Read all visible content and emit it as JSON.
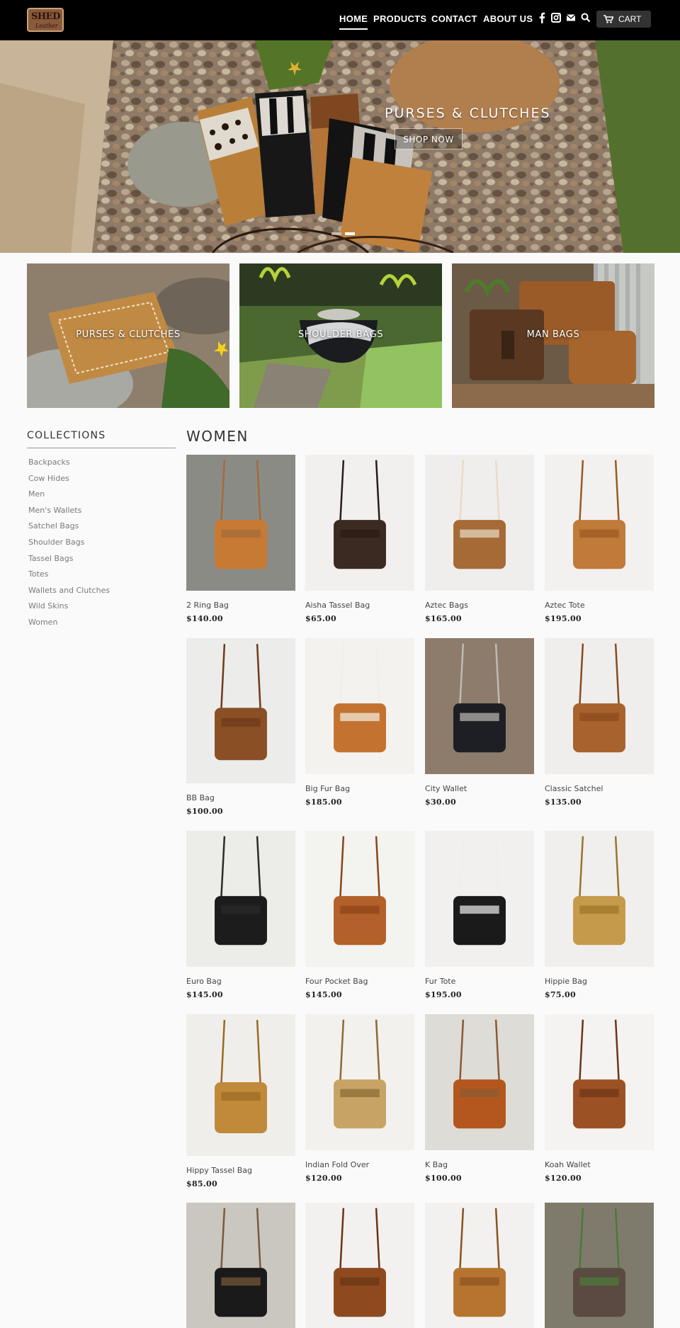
{
  "brand": {
    "logo_line1": "SHED",
    "logo_line2": "Leather"
  },
  "nav": {
    "items": [
      {
        "label": "HOME",
        "active": true
      },
      {
        "label": "PRODUCTS",
        "active": false
      },
      {
        "label": "CONTACT",
        "active": false
      },
      {
        "label": "ABOUT US",
        "active": false
      }
    ],
    "icons": [
      "facebook-icon",
      "instagram-icon",
      "mail-icon",
      "search-icon"
    ],
    "cart_label": "CART"
  },
  "hero": {
    "title": "PURSES & CLUTCHES",
    "button": "SHOP NOW",
    "slides": 2,
    "active_slide": 2
  },
  "features": [
    {
      "label": "PURSES & CLUTCHES"
    },
    {
      "label": "SHOULDER BAGS"
    },
    {
      "label": "MAN BAGS"
    }
  ],
  "sidebar": {
    "title": "COLLECTIONS",
    "links": [
      "Backpacks",
      "Cow Hides",
      "Men",
      "Men's Wallets",
      "Satchel Bags",
      "Shoulder Bags",
      "Tassel Bags",
      "Totes",
      "Wallets and Clutches",
      "Wild Skins",
      "Women"
    ]
  },
  "collection": {
    "title": "WOMEN",
    "products": [
      {
        "name": "2 Ring Bag",
        "price": "$140.00"
      },
      {
        "name": "Aisha Tassel Bag",
        "price": "$65.00"
      },
      {
        "name": "Aztec Bags",
        "price": "$165.00"
      },
      {
        "name": "Aztec Tote",
        "price": "$195.00"
      },
      {
        "name": "BB Bag",
        "price": "$100.00"
      },
      {
        "name": "Big Fur Bag",
        "price": "$185.00"
      },
      {
        "name": "City Wallet",
        "price": "$30.00"
      },
      {
        "name": "Classic Satchel",
        "price": "$135.00"
      },
      {
        "name": "Euro Bag",
        "price": "$145.00"
      },
      {
        "name": "Four Pocket Bag",
        "price": "$145.00"
      },
      {
        "name": "Fur Tote",
        "price": "$195.00"
      },
      {
        "name": "Hippie Bag",
        "price": "$75.00"
      },
      {
        "name": "Hippy Tassel Bag",
        "price": "$85.00"
      },
      {
        "name": "Indian Fold Over",
        "price": "$120.00"
      },
      {
        "name": "K Bag",
        "price": "$100.00"
      },
      {
        "name": "Koah Wallet",
        "price": "$120.00"
      },
      {
        "name": "",
        "price": ""
      },
      {
        "name": "",
        "price": ""
      },
      {
        "name": "",
        "price": ""
      },
      {
        "name": "",
        "price": ""
      }
    ]
  },
  "colors": {
    "header_bg": "#000000",
    "page_bg": "#fafafa",
    "leather": "#b8733a"
  }
}
